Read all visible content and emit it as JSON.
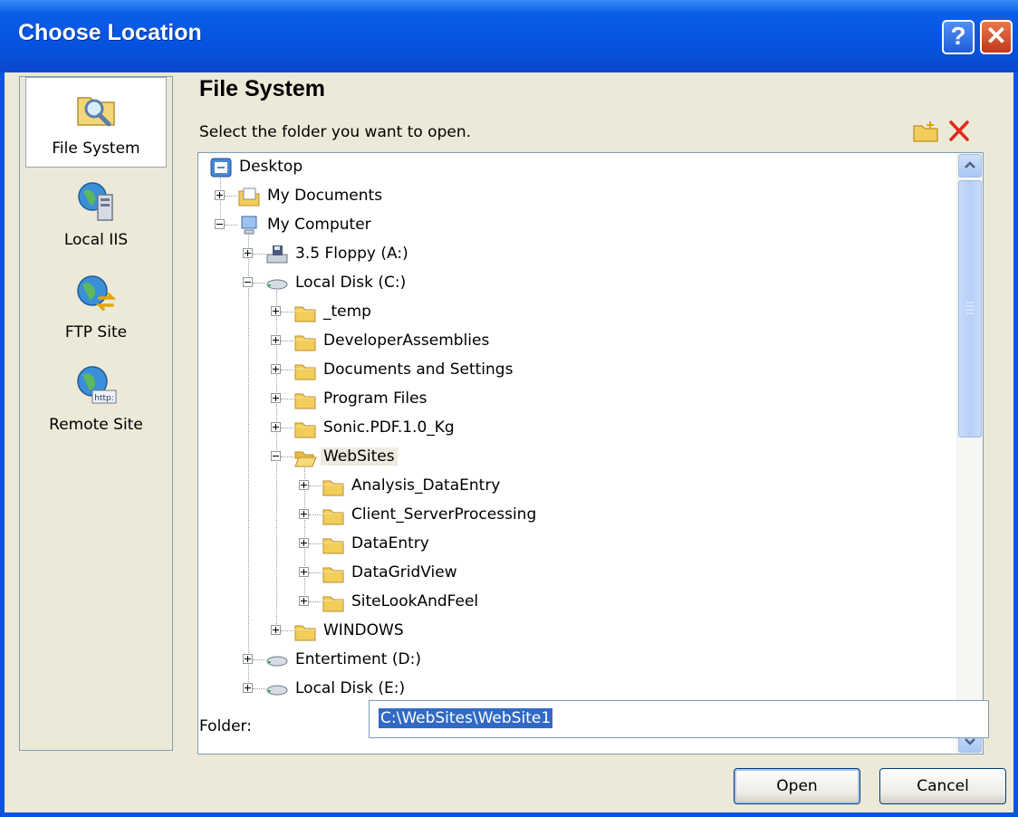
{
  "window": {
    "title": "Choose Location",
    "help_symbol": "?",
    "close_symbol": "✕"
  },
  "places": [
    {
      "label": "File System",
      "icon": "file-system-icon",
      "selected": true
    },
    {
      "label": "Local IIS",
      "icon": "local-iis-icon",
      "selected": false
    },
    {
      "label": "FTP Site",
      "icon": "ftp-site-icon",
      "selected": false
    },
    {
      "label": "Remote Site",
      "icon": "remote-site-icon",
      "selected": false
    }
  ],
  "main": {
    "heading": "File System",
    "prompt": "Select the folder you want to open."
  },
  "tree": [
    {
      "label": "Desktop",
      "icon": "desktop-icon",
      "expander": "none"
    },
    {
      "label": "My Documents",
      "icon": "my-documents-icon",
      "expander": "plus"
    },
    {
      "label": "My Computer",
      "icon": "my-computer-icon",
      "expander": "minus"
    },
    {
      "label": "3.5 Floppy (A:)",
      "icon": "floppy-drive-icon",
      "expander": "plus"
    },
    {
      "label": "Local Disk (C:)",
      "icon": "hard-disk-icon",
      "expander": "minus"
    },
    {
      "label": "_temp",
      "icon": "folder-icon",
      "expander": "plus"
    },
    {
      "label": "DeveloperAssemblies",
      "icon": "folder-icon",
      "expander": "plus"
    },
    {
      "label": "Documents and Settings",
      "icon": "folder-icon",
      "expander": "plus"
    },
    {
      "label": "Program Files",
      "icon": "folder-icon",
      "expander": "plus"
    },
    {
      "label": "Sonic.PDF.1.0_Kg",
      "icon": "folder-icon",
      "expander": "plus"
    },
    {
      "label": "WebSites",
      "icon": "open-folder-icon",
      "expander": "minus",
      "highlighted": true
    },
    {
      "label": "Analysis_DataEntry",
      "icon": "folder-icon",
      "expander": "plus"
    },
    {
      "label": "Client_ServerProcessing",
      "icon": "folder-icon",
      "expander": "plus"
    },
    {
      "label": "DataEntry",
      "icon": "folder-icon",
      "expander": "plus"
    },
    {
      "label": "DataGridView",
      "icon": "folder-icon",
      "expander": "plus"
    },
    {
      "label": "SiteLookAndFeel",
      "icon": "folder-icon",
      "expander": "plus"
    },
    {
      "label": "WINDOWS",
      "icon": "folder-icon",
      "expander": "plus"
    },
    {
      "label": "Entertiment (D:)",
      "icon": "hard-disk-icon",
      "expander": "plus"
    },
    {
      "label": "Local Disk (E:)",
      "icon": "hard-disk-icon",
      "expander": "plus"
    }
  ],
  "folder": {
    "label": "Folder:",
    "value": "C:\\WebSites\\WebSite1"
  },
  "buttons": {
    "open": "Open",
    "cancel": "Cancel"
  },
  "colors": {
    "titlebar": "#0553e0",
    "dialog_bg": "#ece9d8",
    "selection": "#316ac5",
    "folder": "#f2cd5a"
  }
}
